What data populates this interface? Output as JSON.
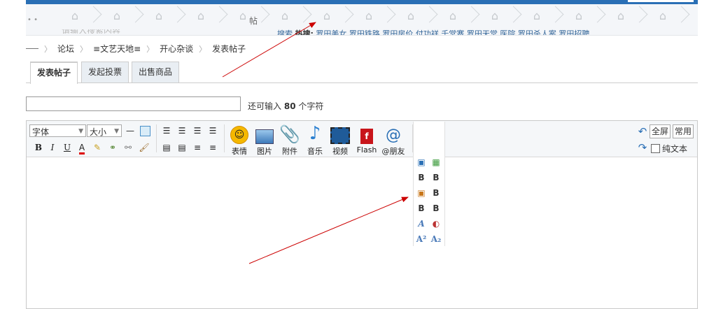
{
  "header": {
    "tie": "帖",
    "search_placeholder": "请输入搜索内容",
    "hot_label": "热搜:",
    "hot_items": [
      "搜索",
      "罗田美女",
      "罗田铁路",
      "罗田房价",
      "付功祥",
      "千堂寨",
      "罗田天堂",
      "医院",
      "罗田杀人案",
      "罗田招聘"
    ]
  },
  "breadcrumb": [
    "论坛",
    "≡文艺天地≡",
    "开心杂谈",
    "发表帖子"
  ],
  "tabs": [
    "发表帖子",
    "发起投票",
    "出售商品"
  ],
  "subject": {
    "value": "",
    "remain_prefix": "还可输入",
    "remain_count": "80",
    "remain_suffix": "个字符"
  },
  "toolbar": {
    "font_select": "字体",
    "size_select": "大小",
    "media": [
      "表情",
      "图片",
      "附件",
      "音乐",
      "视频",
      "Flash",
      "@朋友"
    ],
    "right": {
      "fullscreen": "全屏",
      "common": "常用",
      "plaintext": "纯文本"
    }
  },
  "dropdown": [
    "B",
    "B",
    "B",
    "B",
    "B",
    "B",
    "B"
  ],
  "colors": {
    "link": "#336699",
    "arrow": "#cc0000",
    "header": "#2a6fb5"
  }
}
